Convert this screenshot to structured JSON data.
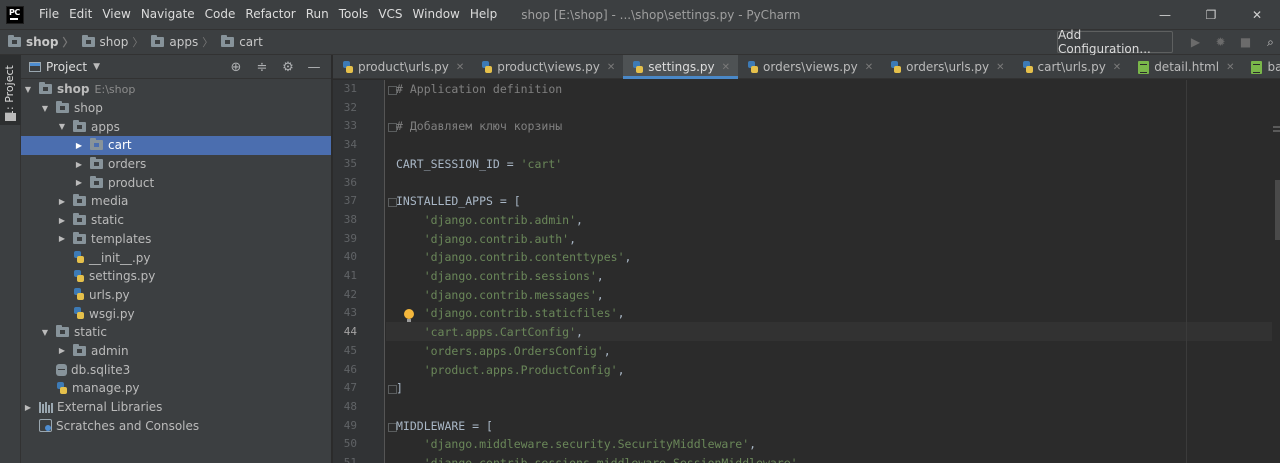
{
  "app": {
    "logo_text": "PC",
    "window_title": "shop [E:\\shop] - ...\\shop\\settings.py - PyCharm",
    "menu": [
      "File",
      "Edit",
      "View",
      "Navigate",
      "Code",
      "Refactor",
      "Run",
      "Tools",
      "VCS",
      "Window",
      "Help"
    ],
    "controls": {
      "minimize": "—",
      "maximize": "❐",
      "close": "✕"
    }
  },
  "navbar": {
    "breadcrumbs": [
      "shop",
      "shop",
      "apps",
      "cart"
    ],
    "run_config_label": "Add Configuration...",
    "icons": [
      "run-icon",
      "debug-icon",
      "stop-icon",
      "search-icon"
    ]
  },
  "toolstrip": {
    "project_tab_label": "1: Project"
  },
  "project_panel": {
    "title": "Project",
    "tree": [
      {
        "label": "shop",
        "hint": "E:\\shop",
        "type": "folder",
        "expanded": true
      },
      {
        "label": "shop",
        "type": "folder",
        "expanded": true
      },
      {
        "label": "apps",
        "type": "folder",
        "expanded": true
      },
      {
        "label": "cart",
        "type": "folder",
        "expanded": false,
        "selected": true
      },
      {
        "label": "orders",
        "type": "folder",
        "expanded": false
      },
      {
        "label": "product",
        "type": "folder",
        "expanded": false
      },
      {
        "label": "media",
        "type": "folder",
        "expanded": false
      },
      {
        "label": "static",
        "type": "folder",
        "expanded": false
      },
      {
        "label": "templates",
        "type": "folder",
        "expanded": false
      },
      {
        "label": "__init__.py",
        "type": "python"
      },
      {
        "label": "settings.py",
        "type": "python"
      },
      {
        "label": "urls.py",
        "type": "python"
      },
      {
        "label": "wsgi.py",
        "type": "python"
      },
      {
        "label": "static",
        "type": "folder",
        "expanded": true
      },
      {
        "label": "admin",
        "type": "folder",
        "expanded": false
      },
      {
        "label": "db.sqlite3",
        "type": "db"
      },
      {
        "label": "manage.py",
        "type": "python"
      },
      {
        "label": "External Libraries",
        "type": "library",
        "expanded": false
      },
      {
        "label": "Scratches and Consoles",
        "type": "scratch"
      }
    ]
  },
  "tabs": [
    {
      "label": "product\\urls.py",
      "type": "python",
      "active": false
    },
    {
      "label": "product\\views.py",
      "type": "python",
      "active": false
    },
    {
      "label": "settings.py",
      "type": "python",
      "active": true
    },
    {
      "label": "orders\\views.py",
      "type": "python",
      "active": false
    },
    {
      "label": "orders\\urls.py",
      "type": "python",
      "active": false
    },
    {
      "label": "cart\\urls.py",
      "type": "python",
      "active": false
    },
    {
      "label": "detail.html",
      "type": "html",
      "active": false
    },
    {
      "label": "base.html",
      "type": "html",
      "active": false
    }
  ],
  "editor": {
    "current_line": 44,
    "lines": [
      {
        "n": "31",
        "text": "# Application definition",
        "kind": "cmt"
      },
      {
        "n": "32",
        "text": "",
        "kind": "plain"
      },
      {
        "n": "33",
        "text": "# Добавляем ключ корзины",
        "kind": "cmt"
      },
      {
        "n": "34",
        "text": "",
        "kind": "plain"
      },
      {
        "n": "35",
        "pre": "CART_SESSION_ID = ",
        "str": "'cart'",
        "post": "",
        "kind": "mix"
      },
      {
        "n": "36",
        "text": "",
        "kind": "plain"
      },
      {
        "n": "37",
        "text": "INSTALLED_APPS = [",
        "kind": "plain"
      },
      {
        "n": "38",
        "pre": "    ",
        "str": "'django.contrib.admin'",
        "post": ",",
        "kind": "mix"
      },
      {
        "n": "39",
        "pre": "    ",
        "str": "'django.contrib.auth'",
        "post": ",",
        "kind": "mix"
      },
      {
        "n": "40",
        "pre": "    ",
        "str": "'django.contrib.contenttypes'",
        "post": ",",
        "kind": "mix"
      },
      {
        "n": "41",
        "pre": "    ",
        "str": "'django.contrib.sessions'",
        "post": ",",
        "kind": "mix"
      },
      {
        "n": "42",
        "pre": "    ",
        "str": "'django.contrib.messages'",
        "post": ",",
        "kind": "mix"
      },
      {
        "n": "43",
        "pre": "    ",
        "str": "'django.contrib.staticfiles'",
        "post": ",",
        "kind": "mix"
      },
      {
        "n": "44",
        "pre": "    ",
        "str": "'cart.apps.CartConfig'",
        "post": ",",
        "kind": "mix"
      },
      {
        "n": "45",
        "pre": "    ",
        "str": "'orders.apps.OrdersConfig'",
        "post": ",",
        "kind": "mix"
      },
      {
        "n": "46",
        "pre": "    ",
        "str": "'product.apps.ProductConfig'",
        "post": ",",
        "kind": "mix"
      },
      {
        "n": "47",
        "text": "]",
        "kind": "plain"
      },
      {
        "n": "48",
        "text": "",
        "kind": "plain"
      },
      {
        "n": "49",
        "text": "MIDDLEWARE = [",
        "kind": "plain"
      },
      {
        "n": "50",
        "pre": "    ",
        "str": "'django.middleware.security.SecurityMiddleware'",
        "post": ",",
        "kind": "mix"
      },
      {
        "n": "51",
        "pre": "    ",
        "str": "'django.contrib.sessions.middleware.SessionMiddleware'",
        "post": ",",
        "kind": "mix"
      }
    ]
  },
  "colors": {
    "background": "#2b2b2b",
    "panel": "#3c3f41",
    "selection": "#4b6eaf",
    "string": "#6a8759",
    "comment": "#808080",
    "text": "#a9b7c6",
    "active_tab_underline": "#4a88c7"
  }
}
